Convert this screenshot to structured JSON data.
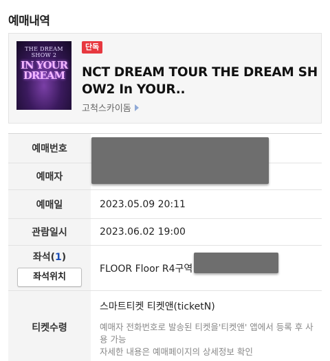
{
  "section_title": "예매내역",
  "event": {
    "poster_top": "THE DREAM SHOW 2",
    "poster_art": "IN YOUR DREAM",
    "badge": "단독",
    "title": "NCT DREAM TOUR THE DREAM SHOW2 In YOUR..",
    "venue": "고척스카이돔"
  },
  "rows": {
    "booking_no": {
      "label": "예매번호",
      "value": ""
    },
    "booker": {
      "label": "예매자",
      "value": ""
    },
    "booking_date": {
      "label": "예매일",
      "value": "2023.05.09 20:11"
    },
    "show_datetime": {
      "label": "관람일시",
      "value": "2023.06.02 19:00"
    },
    "seat": {
      "label": "좌석",
      "count_open": "(",
      "count": "1",
      "count_close": ")",
      "button": "좌석위치",
      "value": "FLOOR Floor R4구역"
    },
    "ticket": {
      "label": "티켓수령",
      "method": "스마트티켓 티켓앤(ticketN)",
      "note_line1": "예매자 전화번호로 발송된 티켓을'티켓앤' 앱에서 등록 후 사용 가능",
      "note_line2": "자세한 내용은 예매페이지의 상세정보 확인"
    }
  },
  "colors": {
    "badge": "#e7383f",
    "seat_count": "#1c4fb8",
    "mask": "#6e6e6e"
  }
}
